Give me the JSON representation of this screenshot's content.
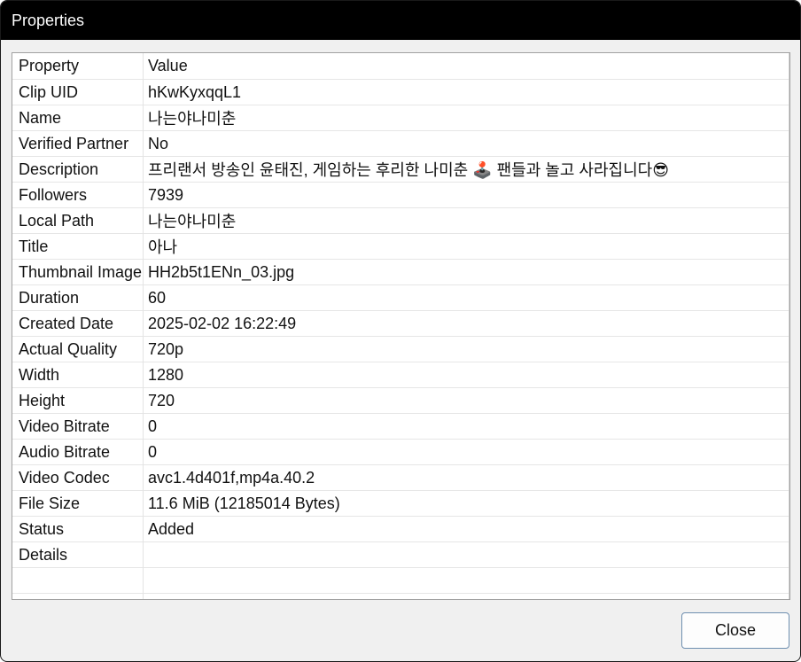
{
  "window": {
    "title": "Properties"
  },
  "table": {
    "headers": {
      "key": "Property",
      "value": "Value"
    },
    "rows": [
      {
        "key": "Clip UID",
        "value": "hKwKyxqqL1"
      },
      {
        "key": "Name",
        "value": "나는야나미춘"
      },
      {
        "key": "Verified Partner",
        "value": "No"
      },
      {
        "key": "Description",
        "value": "프리랜서 방송인 윤태진, 게임하는 후리한 나미춘 🕹️ 팬들과 놀고 사라집니다😎"
      },
      {
        "key": "Followers",
        "value": "7939"
      },
      {
        "key": "Local Path",
        "value": "나는야나미춘"
      },
      {
        "key": "Title",
        "value": "아나"
      },
      {
        "key": "Thumbnail Image",
        "value": "HH2b5t1ENn_03.jpg"
      },
      {
        "key": "Duration",
        "value": "60"
      },
      {
        "key": "Created Date",
        "value": "2025-02-02 16:22:49"
      },
      {
        "key": "Actual Quality",
        "value": "720p"
      },
      {
        "key": "Width",
        "value": "1280"
      },
      {
        "key": "Height",
        "value": "720"
      },
      {
        "key": "Video Bitrate",
        "value": "0"
      },
      {
        "key": "Audio Bitrate",
        "value": "0"
      },
      {
        "key": "Video Codec",
        "value": "avc1.4d401f,mp4a.40.2"
      },
      {
        "key": "File Size",
        "value": "11.6 MiB (12185014 Bytes)"
      },
      {
        "key": "Status",
        "value": "Added"
      },
      {
        "key": "Details",
        "value": ""
      }
    ]
  },
  "buttons": {
    "close_label": "Close"
  }
}
